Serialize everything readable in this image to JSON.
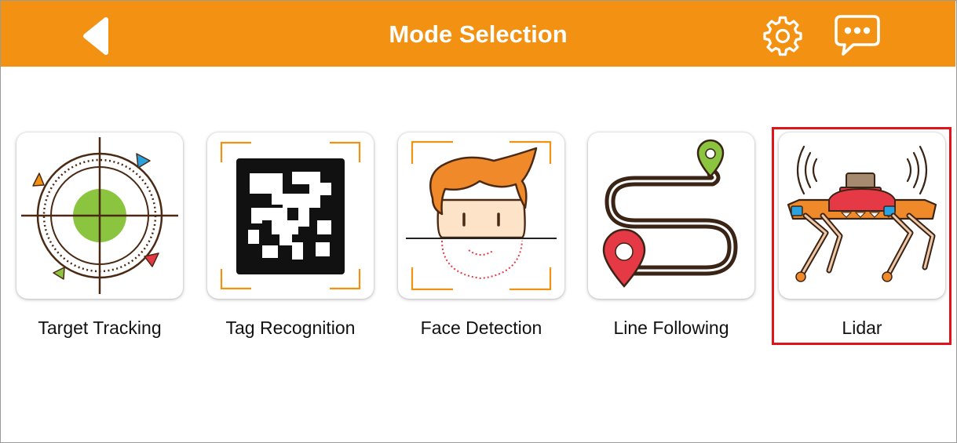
{
  "header": {
    "title": "Mode Selection",
    "background_color": "#f39212",
    "back_icon": "back-arrow-icon",
    "settings_icon": "gear-icon",
    "message_icon": "chat-bubble-icon"
  },
  "modes": [
    {
      "label": "Target Tracking",
      "icon": "target-tracking-icon"
    },
    {
      "label": "Tag Recognition",
      "icon": "tag-recognition-icon"
    },
    {
      "label": "Face Detection",
      "icon": "face-detection-icon"
    },
    {
      "label": "Line Following",
      "icon": "line-following-icon"
    },
    {
      "label": "Lidar",
      "icon": "lidar-robot-dog-icon",
      "highlighted": true
    }
  ],
  "highlight_color": "#e0141b"
}
